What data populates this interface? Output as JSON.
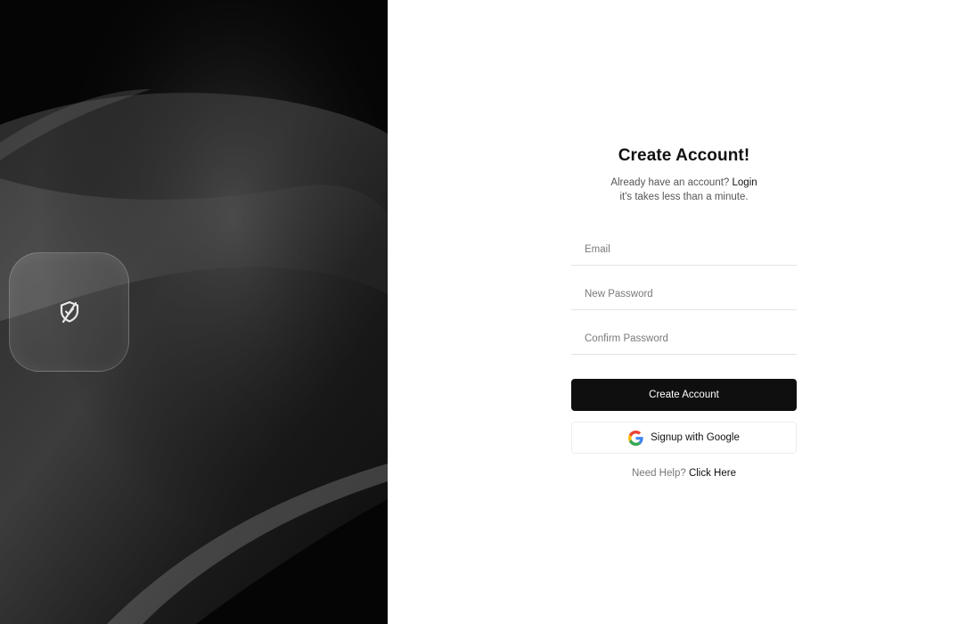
{
  "hero": {
    "logo_icon": "shield-slash-icon"
  },
  "form": {
    "title": "Create Account!",
    "subtitle_prefix": "Already have an account?",
    "login_link": "Login",
    "subtitle_line2": "it's takes less than a minute.",
    "email_placeholder": "Email",
    "new_password_placeholder": "New Password",
    "confirm_password_placeholder": "Confirm Password",
    "create_button": "Create Account",
    "google_button": "Signup with Google",
    "google_icon": "google-icon",
    "help_prefix": "Need Help?",
    "help_link": "Click Here"
  },
  "colors": {
    "primary_button": "#0f0f0f",
    "left_panel_bg": "#050505",
    "page_bg": "#ffffff"
  }
}
